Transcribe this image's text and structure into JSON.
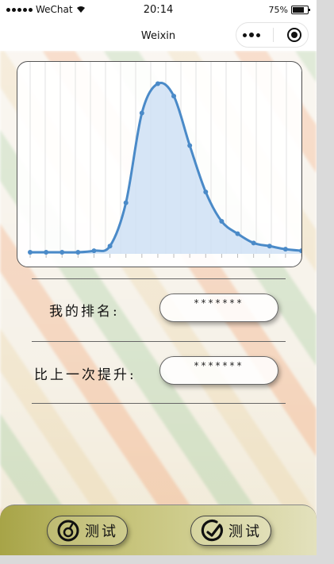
{
  "status_bar": {
    "carrier": "WeChat",
    "time": "20:14",
    "battery": "75%"
  },
  "nav": {
    "title": "Weixin"
  },
  "chart_data": {
    "type": "area",
    "x": [
      1,
      2,
      3,
      4,
      5,
      6,
      7,
      8,
      9,
      10,
      11,
      12,
      13,
      14,
      15,
      16,
      17,
      18
    ],
    "values": [
      1,
      1,
      1,
      1,
      2,
      5,
      33,
      91,
      110,
      102,
      70,
      40,
      21,
      13,
      7,
      5,
      3,
      2
    ],
    "ylim": [
      0,
      120
    ],
    "grid": true,
    "colors": {
      "line": "#4a8ac8",
      "fill": "#cfe0f5"
    }
  },
  "rows": [
    {
      "label": "我的排名:",
      "value": "*******"
    },
    {
      "label": "比上一次提升:",
      "value": "*******"
    }
  ],
  "tabbar": {
    "left": {
      "icon": "refresh-icon",
      "label": "测试"
    },
    "right": {
      "icon": "gauge-icon",
      "label": "测试"
    }
  }
}
